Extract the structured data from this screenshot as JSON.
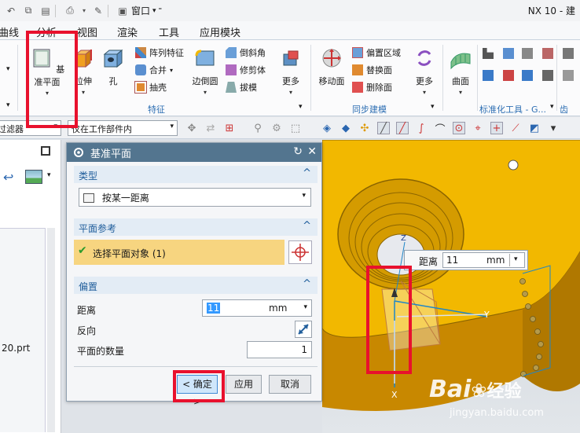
{
  "app": {
    "title": "NX 10 - 建",
    "window_menu": "窗口"
  },
  "tabs": [
    "曲线",
    "分析",
    "视图",
    "渲染",
    "工具",
    "应用模块"
  ],
  "ribbon": {
    "datum_plane": "基准平面",
    "extrude": "拉伸",
    "hole": "孔",
    "pattern_feature": "阵列特征",
    "unite": "合并",
    "shell": "抽壳",
    "edge_blend": "边倒圆",
    "chamfer": "倒斜角",
    "trim_body": "修剪体",
    "draft": "拔模",
    "more1": "更多",
    "move_face": "移动面",
    "offset_region": "偏置区域",
    "replace_face": "替换面",
    "delete_face": "删除面",
    "more2": "更多",
    "surface": "曲面",
    "group_feature": "特征",
    "group_sync": "同步建模",
    "group_std": "标准化工具 - G...",
    "group_gear": "齿轮..."
  },
  "selbar": {
    "filter": "过滤器",
    "scope": "仅在工作部件内"
  },
  "leftpanel": {
    "file_label": "20.prt"
  },
  "dialog": {
    "title": "基准平面",
    "type_section": "类型",
    "type_value": "按某一距离",
    "ref_section": "平面参考",
    "select_object": "选择平面对象 (1)",
    "offset_section": "偏置",
    "distance_label": "距离",
    "distance_value": "11",
    "distance_unit": "mm",
    "reverse_label": "反向",
    "count_label": "平面的数量",
    "count_value": "1",
    "ok": "< 确定 >",
    "apply": "应用",
    "cancel": "取消"
  },
  "viewport": {
    "dist_label": "距离",
    "dist_value": "11",
    "dist_unit": "mm",
    "axis_x": "X",
    "axis_y": "Y",
    "axis_z": "Z"
  },
  "watermark": {
    "brand": "Bai",
    "brand2": "经验",
    "url": "jingyan.baidu.com"
  },
  "colors": {
    "accent": "#1f5d9b",
    "highlight": "#f7d580",
    "titlebar": "#53758f",
    "red": "#e8112d",
    "part": "#f2b800"
  }
}
